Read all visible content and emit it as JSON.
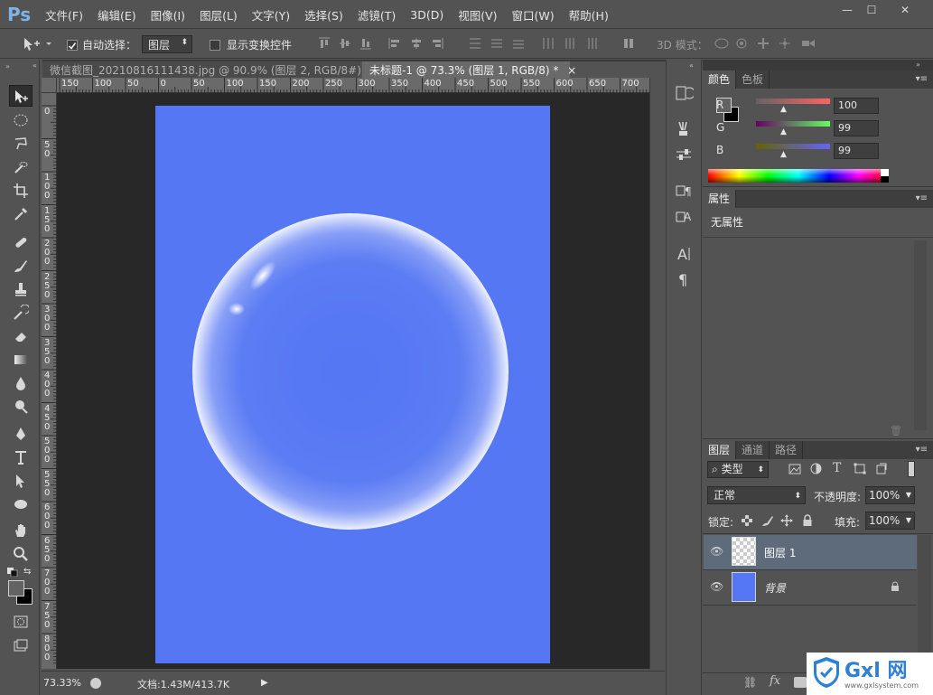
{
  "app": {
    "logo": "Ps"
  },
  "menu": {
    "items": [
      "文件(F)",
      "编辑(E)",
      "图像(I)",
      "图层(L)",
      "文字(Y)",
      "选择(S)",
      "滤镜(T)",
      "3D(D)",
      "视图(V)",
      "窗口(W)",
      "帮助(H)"
    ]
  },
  "window": {
    "minimize": "—",
    "restore": "☐",
    "close": "✕"
  },
  "options": {
    "auto_select_label": "自动选择：",
    "auto_select_target": "图层",
    "show_transform_label": "显示变换控件",
    "mode_3d_label": "3D 模式："
  },
  "tabs": [
    {
      "label": "微信截图_20210816111438.jpg @ 90.9% (图层 2, RGB/8#) *",
      "close": "×"
    },
    {
      "label": "未标题-1 @ 73.3% (图层 1, RGB/8) *",
      "close": "×"
    }
  ],
  "rulers": {
    "top": [
      "150",
      "100",
      "50",
      "0",
      "50",
      "100",
      "150",
      "200",
      "250",
      "300",
      "350",
      "400",
      "450",
      "500",
      "550",
      "600",
      "650",
      "700"
    ],
    "left": [
      "0",
      "5\n0",
      "1\n0\n0",
      "1\n5\n0",
      "2\n0\n0",
      "2\n5\n0",
      "3\n0\n0",
      "3\n5\n0",
      "4\n0\n0",
      "4\n5\n0",
      "5\n0\n0",
      "5\n5\n0",
      "6\n0\n0",
      "6\n5\n0",
      "7\n0\n0",
      "7\n5\n0",
      "8\n0\n0"
    ]
  },
  "status": {
    "zoom": "73.33%",
    "doc_info": "文档:1.43M/413.7K"
  },
  "color_panel": {
    "tabs": [
      "颜色",
      "色板"
    ],
    "channels": [
      {
        "label": "R",
        "value": "100"
      },
      {
        "label": "G",
        "value": "99"
      },
      {
        "label": "B",
        "value": "99"
      }
    ],
    "foreground": "#646363",
    "background": "#000000"
  },
  "properties_panel": {
    "tab": "属性",
    "message": "无属性"
  },
  "layers_panel": {
    "tabs": [
      "图层",
      "通道",
      "路径"
    ],
    "filter_kind": "类型",
    "blend_mode": "正常",
    "opacity_label": "不透明度:",
    "opacity": "100%",
    "lock_label": "锁定:",
    "fill_label": "填充:",
    "fill": "100%",
    "layers": [
      {
        "name": "图层 1",
        "selected": true
      },
      {
        "name": "背景",
        "locked": true
      }
    ]
  },
  "watermark": {
    "brand": "Gxl 网",
    "url": "www.gxlsystem.com"
  },
  "colors": {
    "canvas_blue": "#5577f3",
    "workspace": "#282828",
    "chrome": "#535353",
    "selected_layer": "#5e6b7a"
  }
}
